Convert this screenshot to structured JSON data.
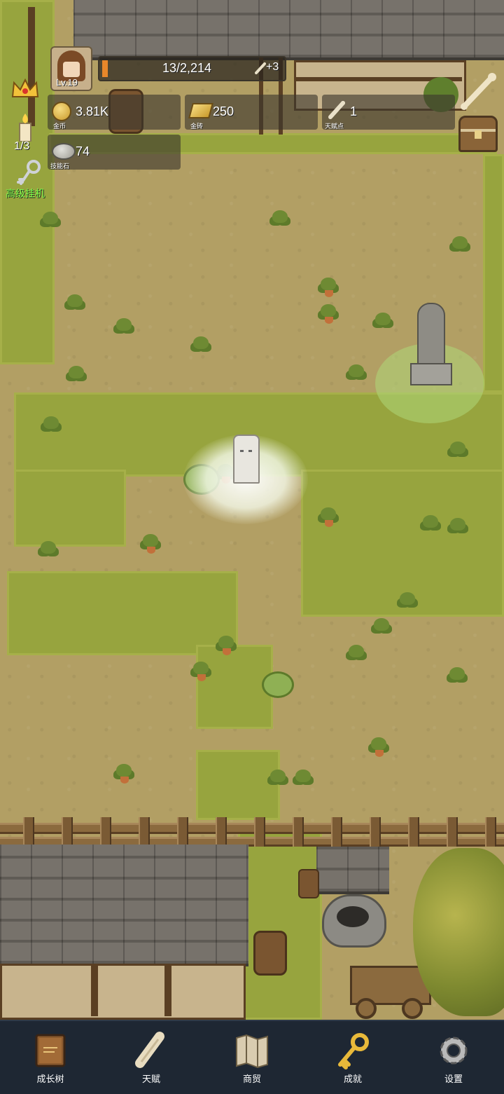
{
  "player": {
    "level": "Lv.19"
  },
  "exp": {
    "progress_text": "13/2,214",
    "bonus": "+3"
  },
  "resources": {
    "gold": {
      "value": "3.81K",
      "label": "金币"
    },
    "gold_brick": {
      "value": "250",
      "label": "金砖"
    },
    "talent_point": {
      "value": "1",
      "label": "天赋点"
    },
    "skill_stone": {
      "value": "74",
      "label": "技能石"
    }
  },
  "side": {
    "candle_count": "1/3",
    "idle_label": "高级挂机"
  },
  "nav": [
    {
      "label": "成长树",
      "icon": "book-icon"
    },
    {
      "label": "天赋",
      "icon": "scroll-icon"
    },
    {
      "label": "商贸",
      "icon": "map-icon"
    },
    {
      "label": "成就",
      "icon": "key-icon"
    },
    {
      "label": "设置",
      "icon": "gear-icon"
    }
  ],
  "colors": {
    "grass": "#97a43e",
    "dirt": "#b29f64",
    "nav_bg": "#1e2733",
    "idle_green": "#7dff4a"
  }
}
